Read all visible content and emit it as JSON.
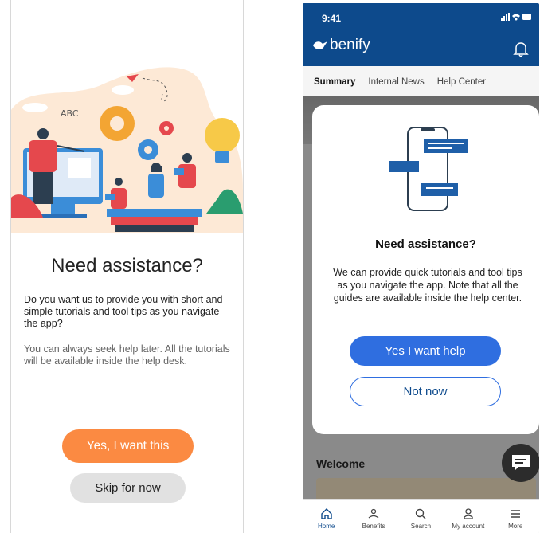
{
  "left": {
    "title": "Need assistance?",
    "description": "Do you want us to provide you with short and simple tutorials and tool tips as you navigate the app?",
    "note": "You can always seek help later. All the tutorials will be available inside the help desk.",
    "primary_button": "Yes, I want this",
    "secondary_button": "Skip for now",
    "illustration_letters": "ABC"
  },
  "right": {
    "status": {
      "time": "9:41"
    },
    "brand": "benify",
    "tabs": [
      {
        "label": "Summary"
      },
      {
        "label": "Internal News"
      },
      {
        "label": "Help Center"
      }
    ],
    "welcome": "Welcome",
    "modal": {
      "title": "Need assistance?",
      "body": "We can provide quick tutorials and tool tips as you navigate the app. Note that all the guides are available inside the help center.",
      "primary_button": "Yes I want help",
      "secondary_button": "Not now"
    },
    "nav": [
      {
        "label": "Home",
        "icon": "home-icon"
      },
      {
        "label": "Benefits",
        "icon": "benefits-icon"
      },
      {
        "label": "Search",
        "icon": "search-icon"
      },
      {
        "label": "My account",
        "icon": "account-icon"
      },
      {
        "label": "More",
        "icon": "menu-icon"
      }
    ]
  },
  "colors": {
    "orange": "#fb8a42",
    "navy": "#0d4a8c",
    "blue": "#2f6ee0"
  }
}
